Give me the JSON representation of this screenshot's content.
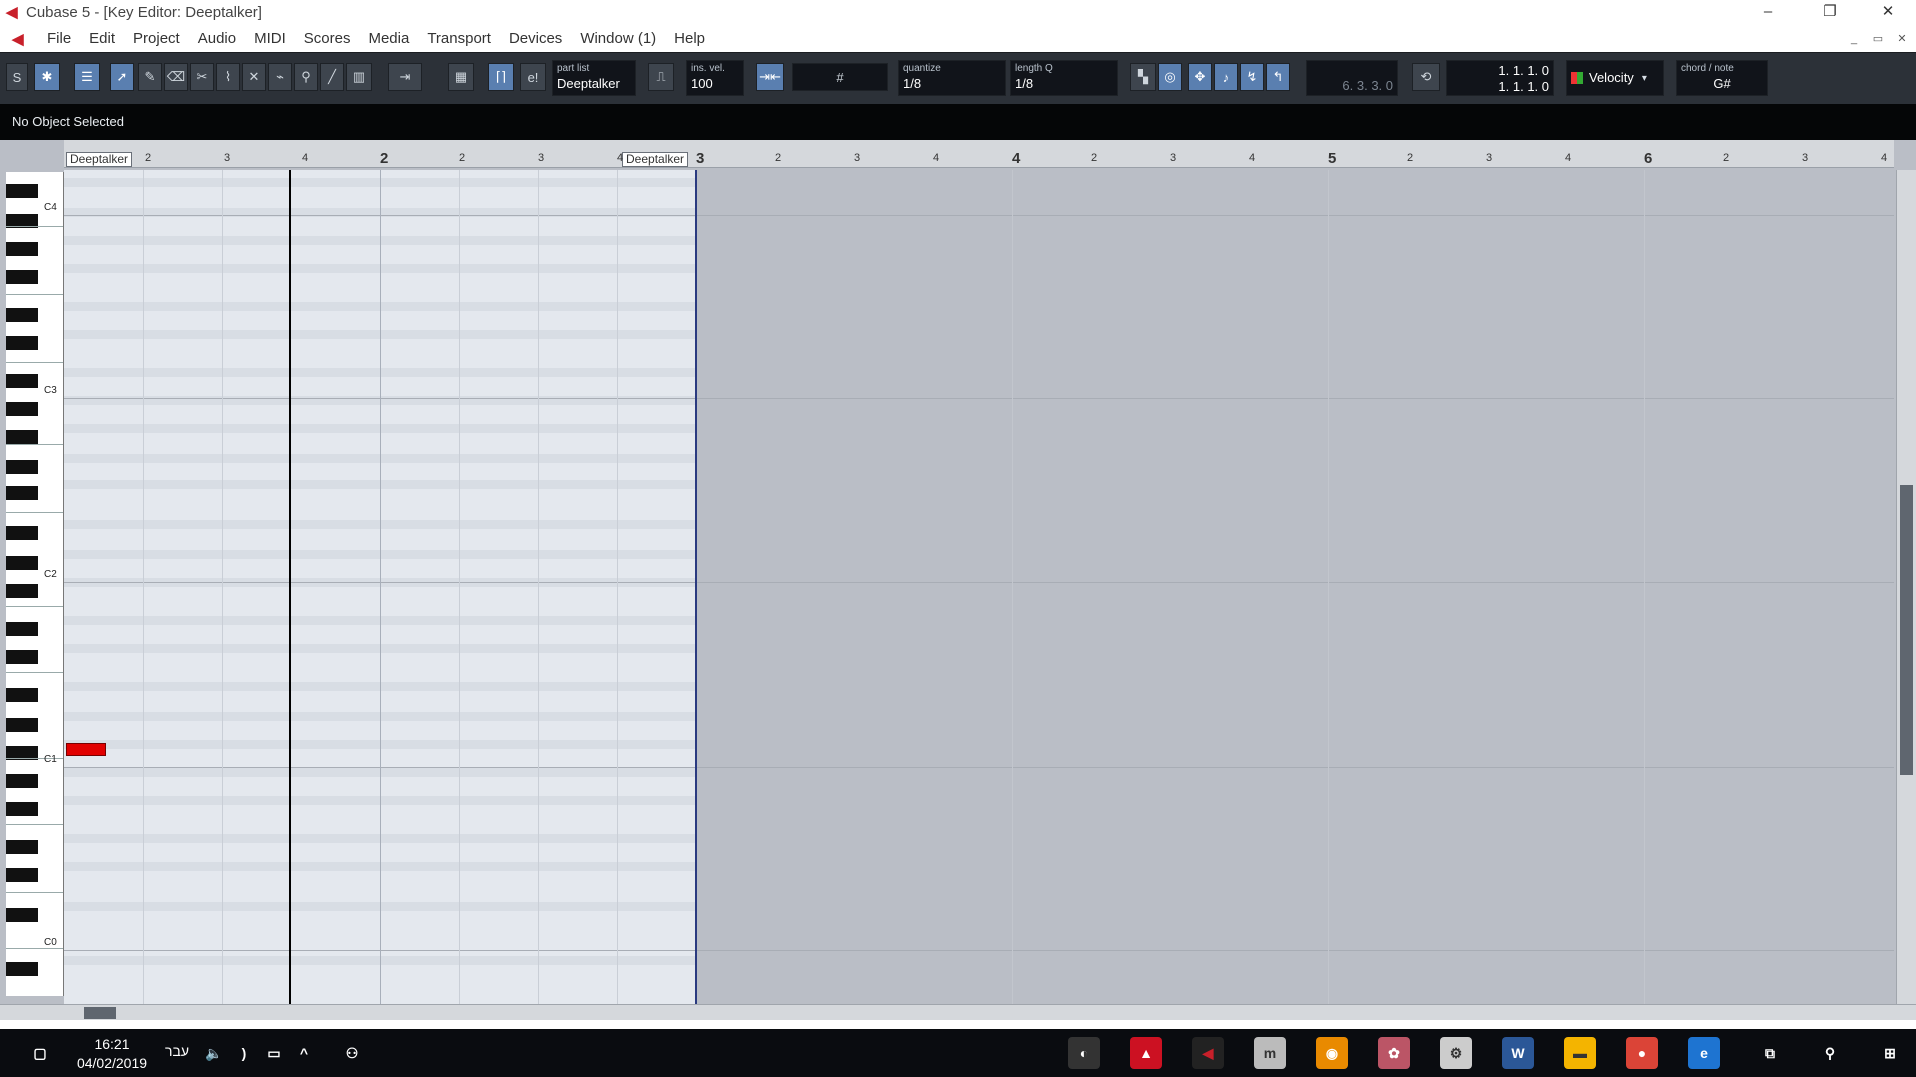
{
  "window": {
    "title": "Cubase 5 - [Key Editor: Deeptalker]",
    "minimize": "–",
    "restore": "❐",
    "close": "✕"
  },
  "menu": [
    "File",
    "Edit",
    "Project",
    "Audio",
    "MIDI",
    "Scores",
    "Media",
    "Transport",
    "Devices",
    "Window (1)",
    "Help"
  ],
  "toolbar": {
    "part_list_label": "part list",
    "part_list_value": "Deeptalker",
    "ins_vel_label": "ins. vel.",
    "ins_vel_value": "100",
    "quantize_label": "quantize",
    "quantize_value": "1/8",
    "length_q_label": "length Q",
    "length_q_value": "1/8",
    "mouse_position": "6. 3. 3.   0",
    "left_locator": "1. 1. 1.   0",
    "right_locator": "1. 1. 1.   0",
    "controller_lane": "Velocity",
    "chord_note_label": "chord / note",
    "chord_note_value": "G#"
  },
  "info_line": "No Object Selected",
  "ruler": {
    "part_label_1": "Deeptalker",
    "part_label_2": "Deeptalker",
    "minor_ticks": [
      "2",
      "3",
      "4",
      "2",
      "3",
      "4",
      "2",
      "3",
      "4",
      "2",
      "3",
      "4",
      "2",
      "3",
      "4",
      "2",
      "3",
      "4"
    ],
    "major_ticks": [
      "2",
      "3",
      "4",
      "5",
      "6"
    ]
  },
  "keyboard": {
    "octaves": [
      "C4",
      "C3",
      "C2",
      "C1",
      "C0"
    ]
  },
  "note": {
    "pitch": "C1",
    "start": "1.1.1.0"
  },
  "taskbar": {
    "time": "16:21",
    "date": "04/02/2019",
    "language": "עבר"
  }
}
